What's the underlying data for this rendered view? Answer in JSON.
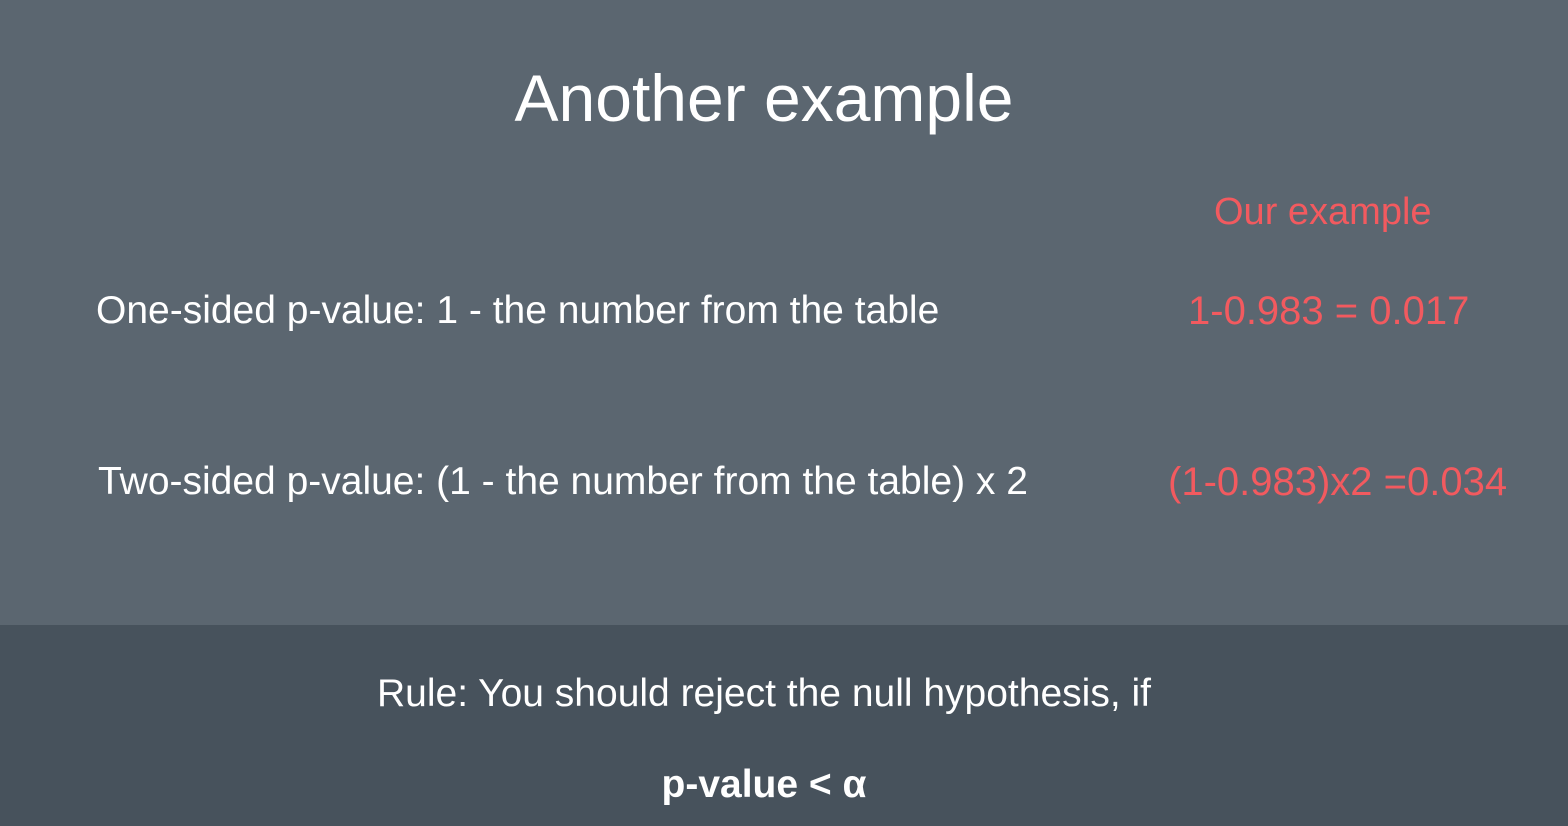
{
  "slide": {
    "title": "Another example",
    "column_header": "Our example",
    "rows": [
      {
        "label": "One-sided p-value: 1 - the number from the table",
        "value": "1-0.983 = 0.017"
      },
      {
        "label": "Two-sided p-value: (1 - the number from the table) x 2",
        "value": "(1-0.983)x2 =0.034"
      }
    ]
  },
  "rule": {
    "text": "Rule: You should reject the null hypothesis, if",
    "formula": "p-value < α"
  },
  "colors": {
    "background": "#5b6670",
    "rule_band": "#47525c",
    "accent": "#f25a5f",
    "text": "#ffffff"
  }
}
